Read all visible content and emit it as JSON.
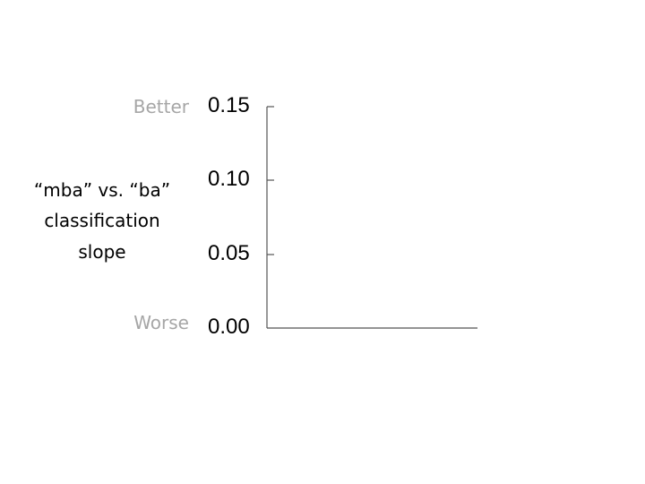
{
  "chart_data": {
    "type": "bar",
    "ylabel": "“mba” vs. “ba” classification slope",
    "ylabel_lines": [
      "“mba” vs. “ba”",
      "classification",
      "slope"
    ],
    "better_label": "Better",
    "worse_label": "Worse",
    "yticks": [
      "0.15",
      "0.10",
      "0.05",
      "0.00"
    ],
    "ytick_values": [
      0.15,
      0.1,
      0.05,
      0.0
    ],
    "ylim": [
      0,
      0.15
    ],
    "categories": [],
    "values": [],
    "grid": false,
    "legend": "none"
  },
  "colors": {
    "text": "#000000",
    "muted_text": "#a6a6a6",
    "axis": "#555555"
  }
}
